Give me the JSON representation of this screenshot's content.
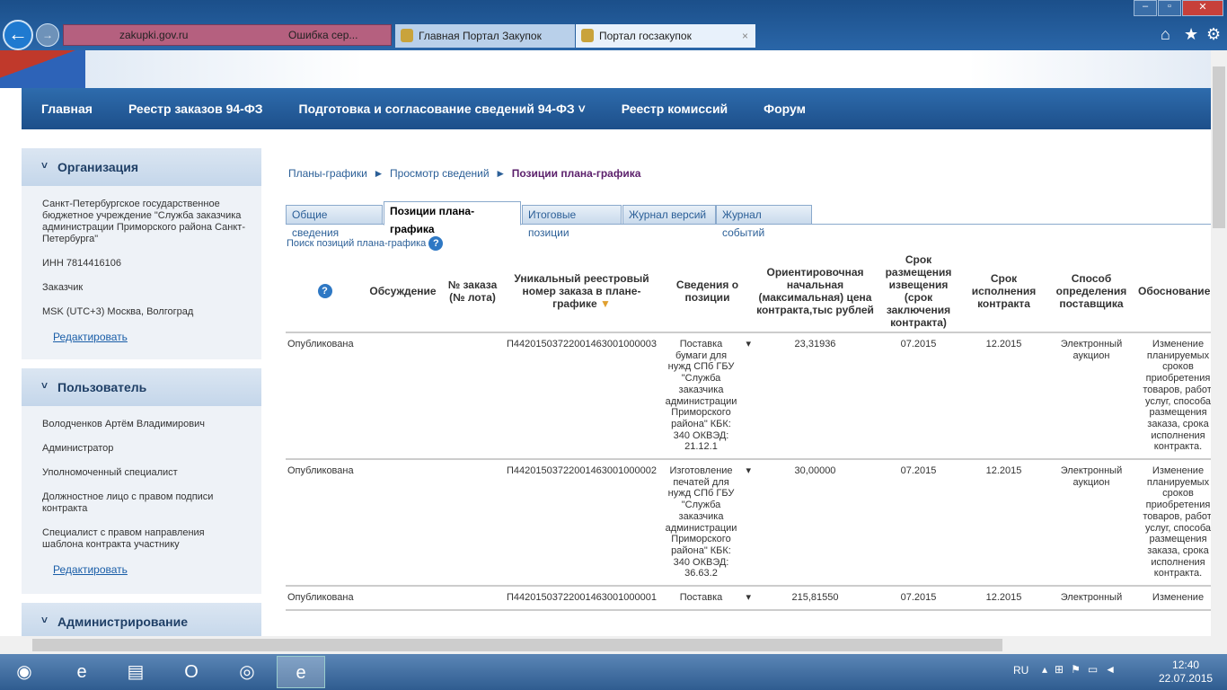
{
  "browser": {
    "url": "zakupki.gov.ru",
    "url_error": "Ошибка сер...",
    "tabs": [
      "Главная Портал Закупок",
      "Портал госзакупок"
    ]
  },
  "nav": [
    "Главная",
    "Реестр заказов 94-ФЗ",
    "Подготовка и согласование сведений 94-ФЗ",
    "Реестр комиссий",
    "Форум"
  ],
  "org": {
    "title": "Организация",
    "name": "Санкт-Петербургское государственное бюджетное учреждение \"Служба заказчика администрации Приморского района Санкт-Петербурга\"",
    "inn": "ИНН 7814416106",
    "role": "Заказчик",
    "tz": "MSK (UTC+3) Москва, Волгоград",
    "edit": "Редактировать"
  },
  "user": {
    "title": "Пользователь",
    "name": "Володченков Артём Владимирович",
    "roles": [
      "Администратор",
      "Уполномоченный специалист",
      "Должностное лицо с правом подписи контракта",
      "Специалист с правом направления шаблона контракта участнику"
    ],
    "edit": "Редактировать"
  },
  "admin": {
    "title": "Администрирование"
  },
  "breadcrumb": [
    "Планы-графики",
    "Просмотр сведений",
    "Позиции плана-графика"
  ],
  "tabs": [
    "Общие сведения",
    "Позиции плана-графика",
    "Итоговые позиции",
    "Журнал версий",
    "Журнал событий"
  ],
  "search_link": "Поиск позиций плана-графика",
  "columns": [
    "?",
    "Обсуждение",
    "№ заказа (№ лота)",
    "Уникальный реестровый номер заказа в плане-графике",
    "Сведения о позиции",
    "Ориентировочная начальная (максимальная) цена контракта,тыс рублей",
    "Срок размещения извещения (срок заключения контракта)",
    "Срок исполнения контракта",
    "Способ определения поставщика",
    "Обоснование внесения изменений"
  ],
  "rows": [
    {
      "status": "Опубликована",
      "reg": "П44201503722001463001000003",
      "info": "Поставка бумаги для нужд СПб ГБУ \"Служба заказчика администрации Приморского района\" КБК: 340 ОКВЭД: 21.12.1",
      "price": "23,31936",
      "date": "07.2015",
      "exec": "12.2015",
      "method": "Электронный аукцион",
      "reason": "Изменение планируемых сроков приобретения товаров, работ, услуг, способа размещения заказа, срока исполнения контракта."
    },
    {
      "status": "Опубликована",
      "reg": "П44201503722001463001000002",
      "info": "Изготовление печатей для нужд СПб ГБУ \"Служба заказчика администрации Приморского района\" КБК: 340 ОКВЭД: 36.63.2",
      "price": "30,00000",
      "date": "07.2015",
      "exec": "12.2015",
      "method": "Электронный аукцион",
      "reason": "Изменение планируемых сроков приобретения товаров, работ, услуг, способа размещения заказа, срока исполнения контракта."
    },
    {
      "status": "Опубликована",
      "reg": "П44201503722001463001000001",
      "info": "Поставка",
      "price": "215,81550",
      "date": "07.2015",
      "exec": "12.2015",
      "method": "Электронный",
      "reason": "Изменение"
    }
  ],
  "taskbar": {
    "lang": "RU",
    "time": "12:40",
    "date": "22.07.2015"
  }
}
